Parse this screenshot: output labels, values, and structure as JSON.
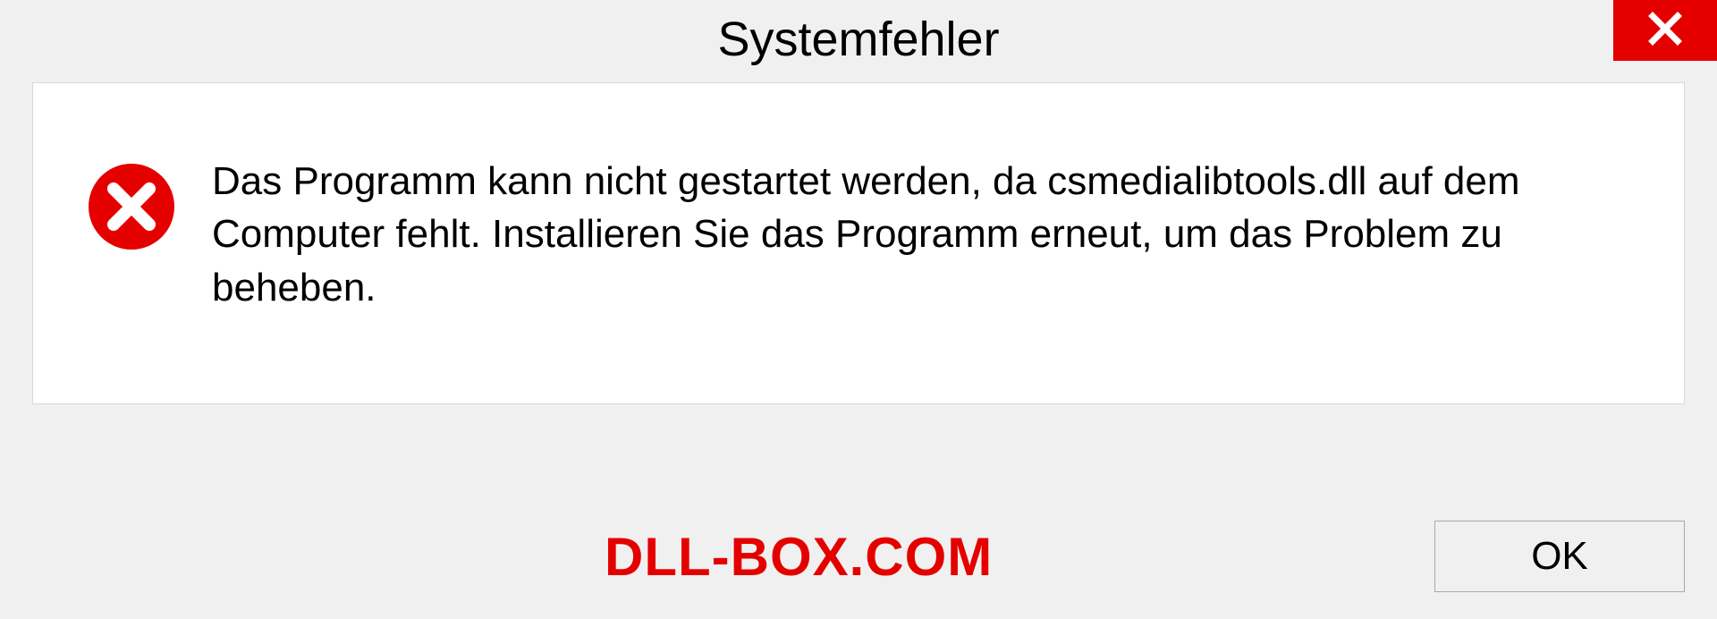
{
  "dialog": {
    "title": "Systemfehler",
    "message": "Das Programm kann nicht gestartet werden, da csmedialibtools.dll auf dem Computer fehlt. Installieren Sie das Programm erneut, um das Problem zu beheben.",
    "ok_label": "OK"
  },
  "watermark": "DLL-BOX.COM",
  "colors": {
    "error_red": "#e50000",
    "background": "#f0f0f0",
    "panel": "#ffffff"
  },
  "icons": {
    "close": "close-icon",
    "error": "error-circle-icon"
  }
}
